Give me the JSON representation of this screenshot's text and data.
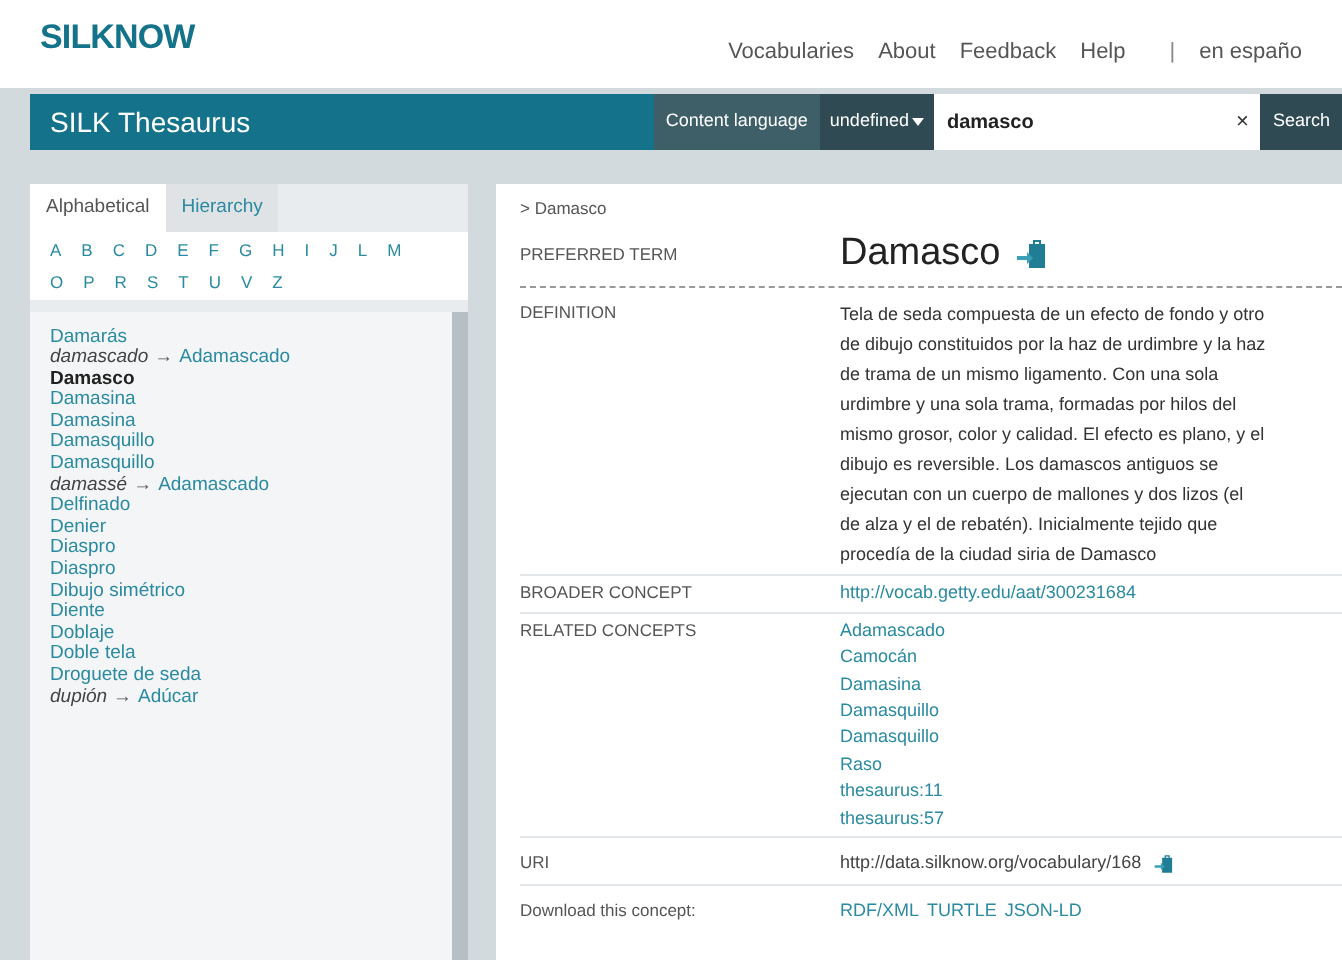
{
  "header": {
    "logo": "SILKNOW",
    "nav": [
      "Vocabularies",
      "About",
      "Feedback",
      "Help"
    ],
    "separator": "|",
    "language": "en españo"
  },
  "toolbar": {
    "title": "SILK Thesaurus",
    "content_language_label": "Content language",
    "language_select": "undefined",
    "search_value": "damasco",
    "clear": "×",
    "search_button": "Search"
  },
  "sidebar": {
    "tabs": [
      {
        "label": "Alphabetical",
        "selected": true
      },
      {
        "label": "Hierarchy",
        "selected": false
      }
    ],
    "letters": [
      [
        "A",
        "B",
        "C",
        "D",
        "E",
        "F",
        "G",
        "H",
        "I",
        "J",
        "L",
        "M"
      ],
      [
        "O",
        "P",
        "R",
        "S",
        "T",
        "U",
        "V",
        "Z"
      ]
    ],
    "items": [
      {
        "term": "Damarás",
        "selected": false
      },
      {
        "term": "damascado",
        "arrow": "→",
        "see": "Adamascado",
        "selected": false
      },
      {
        "term": "Damasco",
        "selected": true
      },
      {
        "term": "Damasina",
        "selected": false
      },
      {
        "term": "Damasina",
        "selected": false
      },
      {
        "term": "Damasquillo",
        "selected": false
      },
      {
        "term": "Damasquillo",
        "selected": false
      },
      {
        "term": "damassé",
        "arrow": "→",
        "see": "Adamascado",
        "selected": false
      },
      {
        "term": "Delfinado",
        "selected": false
      },
      {
        "term": "Denier",
        "selected": false
      },
      {
        "term": "Diaspro",
        "selected": false
      },
      {
        "term": "Diaspro",
        "selected": false
      },
      {
        "term": "Dibujo simétrico",
        "selected": false
      },
      {
        "term": "Diente",
        "selected": false
      },
      {
        "term": "Doblaje",
        "selected": false
      },
      {
        "term": "Doble tela",
        "selected": false
      },
      {
        "term": "Droguete de seda",
        "selected": false
      },
      {
        "term": "dupión",
        "arrow": "→",
        "see": "Adúcar",
        "selected": false
      }
    ]
  },
  "concept": {
    "breadcrumb": "> Damasco",
    "preferred_label": "PREFERRED TERM",
    "preferred_term": "Damasco",
    "definition_label": "DEFINITION",
    "definition": "Tela de seda compuesta de un efecto de fondo y otro de dibujo constituidos por la haz de urdimbre y la haz de trama de un mismo ligamento. Con una sola urdimbre y una sola trama, formadas por hilos del mismo grosor, color y calidad. El efecto es plano, y el dibujo es reversible. Los damascos antiguos se ejecutan con un cuerpo de mallones y dos lizos (el de alza y el de rebatén). Inicialmente tejido que procedía de la ciudad siria de Damasco",
    "broader_label": "BROADER CONCEPT",
    "broader": "http://vocab.getty.edu/aat/300231684",
    "related_label": "RELATED CONCEPTS",
    "related": [
      "Adamascado",
      "Camocán",
      "Damasina",
      "Damasquillo",
      "Damasquillo",
      "Raso",
      "thesaurus:11",
      "thesaurus:57"
    ],
    "uri_label": "URI",
    "uri": "http://data.silknow.org/vocabulary/168",
    "download_label": "Download this concept:",
    "downloads": [
      "RDF/XML",
      "TURTLE",
      "JSON-LD"
    ]
  }
}
